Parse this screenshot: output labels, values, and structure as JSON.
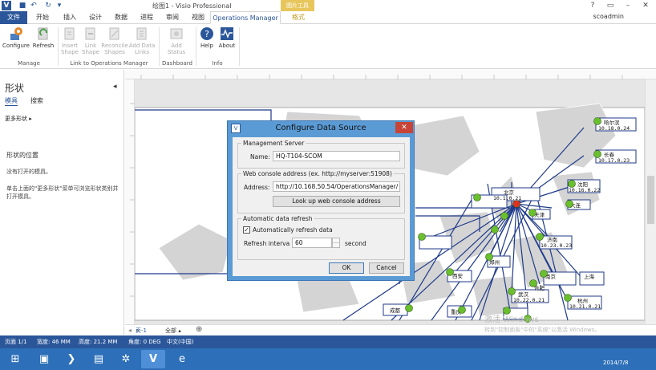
{
  "titlebar": {
    "app_title": "绘图1 - Visio Professional",
    "context_group": "图片工具",
    "user": "scoadmin"
  },
  "tabs": [
    "文件",
    "开始",
    "插入",
    "设计",
    "数据",
    "进程",
    "审阅",
    "视图",
    "Operations Manager",
    "格式"
  ],
  "ribbon": {
    "buttons": {
      "configure": "Configure",
      "refresh": "Refresh",
      "insert_shape": "Insert Shape",
      "link_shape": "Link Shape",
      "reconcile_shapes": "Reconcile Shapes",
      "add_data_links": "Add Data Links",
      "add_status": "Add Status",
      "help": "Help",
      "about": "About"
    },
    "groups": {
      "manage": "Manage",
      "link": "Link to Operations Manager",
      "dashboard": "Dashboard",
      "info": "Info"
    }
  },
  "left_pane": {
    "title": "形状",
    "tab_stencils": "模具",
    "tab_search": "搜索",
    "more_shapes": "更多形状",
    "position_heading": "形状的位置",
    "no_stencils": "没有打开的模具。",
    "hint": "单击上面的\"更多形状\"菜单可浏览形状类别并打开模具。"
  },
  "dialog": {
    "title": "Configure Data Source",
    "management_server": {
      "legend": "Management Server",
      "name_label": "Name:",
      "name_value": "HQ-T104-SCOM"
    },
    "web_console": {
      "legend": "Web console address (ex. http://myserver:51908)",
      "address_label": "Address:",
      "address_value": "http://10.168.50.54/OperationsManager/",
      "lookup_button": "Look up web console address"
    },
    "auto_refresh": {
      "legend": "Automatic data refresh",
      "checkbox_label": "Automatically refresh data",
      "checked": true,
      "interval_label": "Refresh interva",
      "interval_value": "60",
      "unit_label": "second"
    },
    "ok_button": "OK",
    "cancel_button": "Cancel"
  },
  "map": {
    "nodes": [
      {
        "name": "哈尔滨",
        "ip": "10.18.0.24",
        "status": "green"
      },
      {
        "name": "长春",
        "ip": "10.17.0.23",
        "status": "green"
      },
      {
        "name": "沈阳",
        "ip": "10.16.0.22",
        "status": "green"
      },
      {
        "name": "大连",
        "ip": "",
        "status": "green"
      },
      {
        "name": "北京",
        "ip": "10.1.0.21",
        "status": "red"
      },
      {
        "name": "天津",
        "ip": "",
        "status": "green"
      },
      {
        "name": "济南",
        "ip": "10.23.0.23",
        "status": "green"
      },
      {
        "name": "郑州",
        "ip": "",
        "status": "green"
      },
      {
        "name": "南京",
        "ip": "",
        "status": "green"
      },
      {
        "name": "上海",
        "ip": "",
        "status": "green"
      },
      {
        "name": "合肥",
        "ip": "",
        "status": "green"
      },
      {
        "name": "武汉",
        "ip": "10.22.0.21",
        "status": "green"
      },
      {
        "name": "杭州",
        "ip": "10.21.0.21",
        "status": "green"
      },
      {
        "name": "成都",
        "ip": "",
        "status": "green"
      },
      {
        "name": "重庆",
        "ip": "",
        "status": "green"
      },
      {
        "name": "西安",
        "ip": "",
        "status": "green"
      }
    ],
    "watermark_line1": "激活 Windows",
    "watermark_line2": "转到\"控制面板\"中的\"系统\"以激活 Windows。"
  },
  "pagebar": {
    "page_tab": "页-1",
    "all_pages": "全部"
  },
  "statusbar": {
    "page": "页面 1/1",
    "width": "宽度: 46 MM",
    "height": "高度: 21.2 MM",
    "angle": "角度: 0 DEG",
    "lang": "中文(中国)"
  },
  "taskbar": {
    "clock": "2014/7/8"
  },
  "colors": {
    "accent": "#2b579a",
    "context_tab": "#e7c65c",
    "dialog_frame": "#5b9bd5",
    "close_red": "#c74437",
    "node_green": "#6abf2e",
    "node_red": "#e03020",
    "link_line": "#1f3a8a"
  }
}
